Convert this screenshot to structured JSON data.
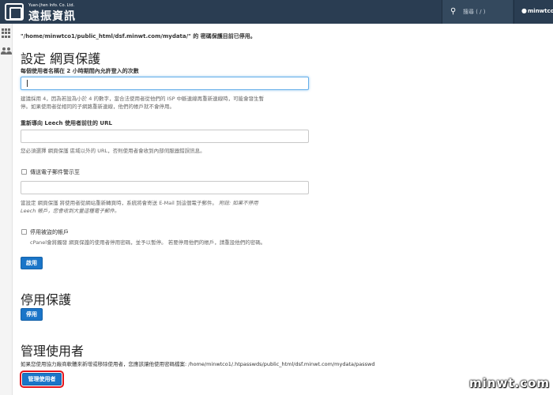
{
  "topbar": {
    "logo_en": "Yuan-Jhen Info. Co. Ltd.",
    "logo_zh": "遠振資訊",
    "search_placeholder": "搜尋 ( / )",
    "username": "minwtco1"
  },
  "notice": "\"/home/minwtco1/public_html/dsf.minwt.com/mydata/\" 的 密碼保護目前已停用。",
  "setup": {
    "heading": "設定 網頁保護",
    "attempts_label": "每個使用者名稱在 2 小時期間內允許登入的次數",
    "attempts_value": "",
    "attempts_help_1": "建議採用 4，因為若設為小於 4 的數字，當合法使用者從他們的 ISP 中斷連線再重新連線時，可能會發生暫",
    "attempts_help_2": "停。如果使用者從相同的子網路重新連線，他們的帳戶就不會停用。",
    "redirect_label": "重新導向 Leech 使用者前往的 URL",
    "redirect_value": "",
    "redirect_help": "您必須選擇 網頁保護 區域以外的 URL，否則使用者會收到內部伺服器錯誤訊息。",
    "email_checkbox_label": "傳送電子郵件警示至",
    "email_value": "",
    "email_help_1": "當設定 網頁保護 將使用者從網站重新轉頁時，系統將會寄送 E-Mail 到這個電子郵件。",
    "email_help_note": "附註: 如果不停用",
    "email_help_2": "Leech 帳戶，您會收到大量這種電子郵件。",
    "disable_checkbox_label": "停用被盜的帳戶",
    "disable_help_1": "cPanel會將觸發 網頁保護的使用者停用密碼，並予以暫停。 若要停用他們的帳戶，請重設他們的密碼。",
    "enable_button": "啟用"
  },
  "disable_section": {
    "heading": "停用保護",
    "button": "停用"
  },
  "manage_section": {
    "heading": "管理使用者",
    "desc": "如果您使用協力廠商軟體來新增或移除使用者，您應該讓他使用密碼檔案: /home/minwtco1/.htpasswds/public_html/dsf.minwt.com/mydata/passwd",
    "button": "管理使用者"
  },
  "watermark": "minwt.com",
  "icons": {
    "search": "search-icon",
    "user": "user-icon",
    "apps": "grid-icon",
    "users": "users-icon"
  },
  "colors": {
    "topbar": "#2a3d52",
    "primary_button": "#1a75c8",
    "highlight": "#e3141b"
  }
}
